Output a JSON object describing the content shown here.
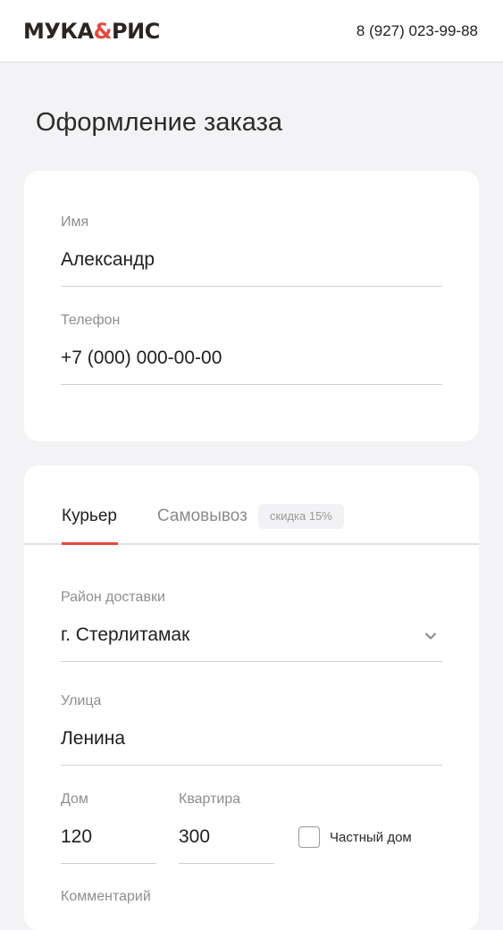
{
  "header": {
    "logo_left": "МУКА",
    "logo_amp": "&",
    "logo_right": "РИС",
    "phone": "8 (927) 023-99-88"
  },
  "page": {
    "title": "Оформление заказа"
  },
  "contact": {
    "name_label": "Имя",
    "name_value": "Александр",
    "phone_label": "Телефон",
    "phone_value": "+7 (000) 000-00-00"
  },
  "delivery": {
    "tabs": [
      {
        "label": "Курьер",
        "active": true
      },
      {
        "label": "Самовывоз",
        "active": false
      }
    ],
    "pickup_badge": "скидка 15%",
    "district_label": "Район доставки",
    "district_value": "г. Стерлитамак",
    "street_label": "Улица",
    "street_value": "Ленина",
    "house_label": "Дом",
    "house_value": "120",
    "apartment_label": "Квартира",
    "apartment_value": "300",
    "private_house_label": "Частный дом",
    "private_house_checked": false,
    "next_label": "Комментарий"
  },
  "colors": {
    "accent": "#e4493f",
    "background": "#f3f2f4",
    "card": "#ffffff"
  },
  "icons": {
    "district_dropdown": "chevron-down-icon"
  }
}
